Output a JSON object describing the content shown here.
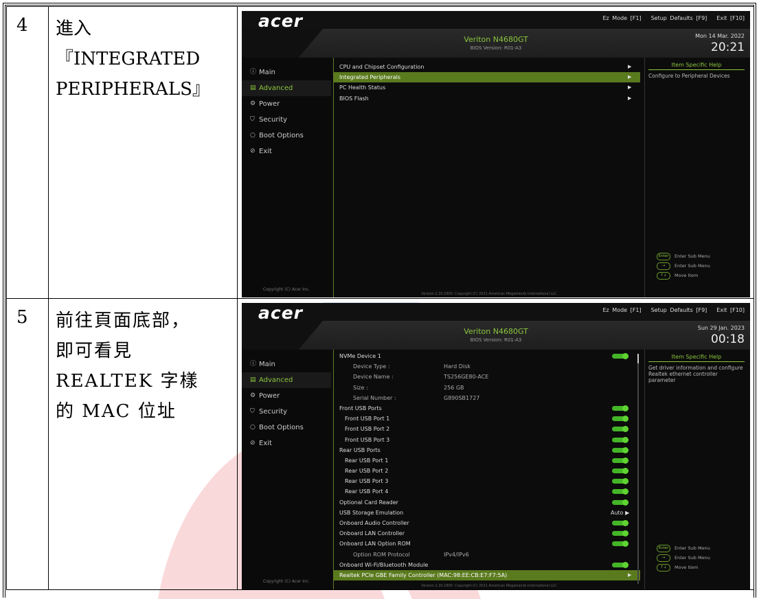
{
  "steps": [
    {
      "number": "4",
      "text": "進入『INTEGRATED PERIPHERALS』",
      "bios": {
        "logo": "acer",
        "hotkeys": [
          "Ez Mode [F1]",
          "Setup Defaults [F9]",
          "Exit [F10]"
        ],
        "model": "Veriton N4680GT",
        "bios_version": "BIOS Version: R01-A3",
        "date": "Mon 14 Mar. 2022",
        "time": "20:21",
        "nav": [
          "Main",
          "Advanced",
          "Power",
          "Security",
          "Boot Options",
          "Exit"
        ],
        "nav_selected": "Advanced",
        "copyright": "Copyright (C) Acer Inc.",
        "menu": [
          {
            "label": "CPU and Chipset Configuration",
            "arrow": "▶"
          },
          {
            "label": "Integrated Peripherals",
            "arrow": "▶"
          },
          {
            "label": "PC Health Status",
            "arrow": "▶"
          },
          {
            "label": "BIOS Flash",
            "arrow": "▶"
          }
        ],
        "help_title": "Item Specific Help",
        "help_text": "Configure to Peripheral Devices",
        "keys": [
          {
            "key": "Enter",
            "label": "Enter Sub Menu"
          },
          {
            "key": "→",
            "label": "Enter Sub Menu"
          },
          {
            "key": "↑↓",
            "label": "Move Item"
          }
        ],
        "footer": "Version 2.20.1800. Copyright (C) 2021 American Megatrends International LLC"
      }
    },
    {
      "number": "5",
      "text": "前往頁面底部，即可看見 REALTEK 字樣的 MAC 位址",
      "bios": {
        "logo": "acer",
        "hotkeys": [
          "Ez Mode [F1]",
          "Setup Defaults [F9]",
          "Exit [F10]"
        ],
        "model": "Veriton N4680GT",
        "bios_version": "BIOS Version: R01-A3",
        "date": "Sun 29 Jan. 2023",
        "time": "00:18",
        "nav": [
          "Main",
          "Advanced",
          "Power",
          "Security",
          "Boot Options",
          "Exit"
        ],
        "nav_selected": "Advanced",
        "copyright": "Copyright (C) Acer Inc.",
        "menu": [
          {
            "label": "NVMe Device 1",
            "toggle": true
          },
          {
            "label": "Device Type  :",
            "value": "Hard Disk",
            "indent": 2
          },
          {
            "label": "Device Name  :",
            "value": "TS256GE80-ACE",
            "indent": 2
          },
          {
            "label": "Size      :",
            "value": "256 GB",
            "indent": 2
          },
          {
            "label": "Serial Number :",
            "value": "G890SB1727",
            "indent": 2
          },
          {
            "label": "Front USB Ports",
            "toggle": true
          },
          {
            "label": "Front USB Port 1",
            "toggle": true,
            "indent": 1
          },
          {
            "label": "Front USB Port 2",
            "toggle": true,
            "indent": 1
          },
          {
            "label": "Front USB Port 3",
            "toggle": true,
            "indent": 1
          },
          {
            "label": "Rear USB Ports",
            "toggle": true
          },
          {
            "label": "Rear USB Port 1",
            "toggle": true,
            "indent": 1
          },
          {
            "label": "Rear USB Port 2",
            "toggle": true,
            "indent": 1
          },
          {
            "label": "Rear USB Port 3",
            "toggle": true,
            "indent": 1
          },
          {
            "label": "Rear USB Port 4",
            "toggle": true,
            "indent": 1
          },
          {
            "label": "Optional Card Reader",
            "toggle": true
          },
          {
            "label": "USB Storage Emulation",
            "value_right": "Auto ▶"
          },
          {
            "label": "Onboard Audio Controller",
            "toggle": true
          },
          {
            "label": "Onboard LAN Controller",
            "toggle": true
          },
          {
            "label": "Onboard LAN Option ROM",
            "toggle": true
          },
          {
            "label": "Option ROM Protocol",
            "value": "IPv4/IPv6",
            "indent": 2
          },
          {
            "label": "Onboard Wi-Fi/Bluetooth Module",
            "toggle": true
          },
          {
            "label": "Realtek PCIe GBE Family Controller (MAC:98:EE:CB:E7:F7:5A)",
            "arrow": "▶"
          }
        ],
        "help_title": "Item Specific Help",
        "help_text": "Get driver information and configure Realtek ethernet controller parameter",
        "keys": [
          {
            "key": "Enter",
            "label": "Enter Sub Menu"
          },
          {
            "key": "→",
            "label": "Enter Sub Menu"
          },
          {
            "key": "↑↓",
            "label": "Move Item"
          }
        ],
        "footer": "Version 2.20.1800. Copyright (C) 2021 American Megatrends International LLC"
      }
    }
  ],
  "colors": {
    "accent": "#8cc63f",
    "toggle": "#44b527",
    "selected_row": "#5a7a1e",
    "watermark_red": "#e8323c",
    "watermark_blue": "#2b6cd6"
  }
}
